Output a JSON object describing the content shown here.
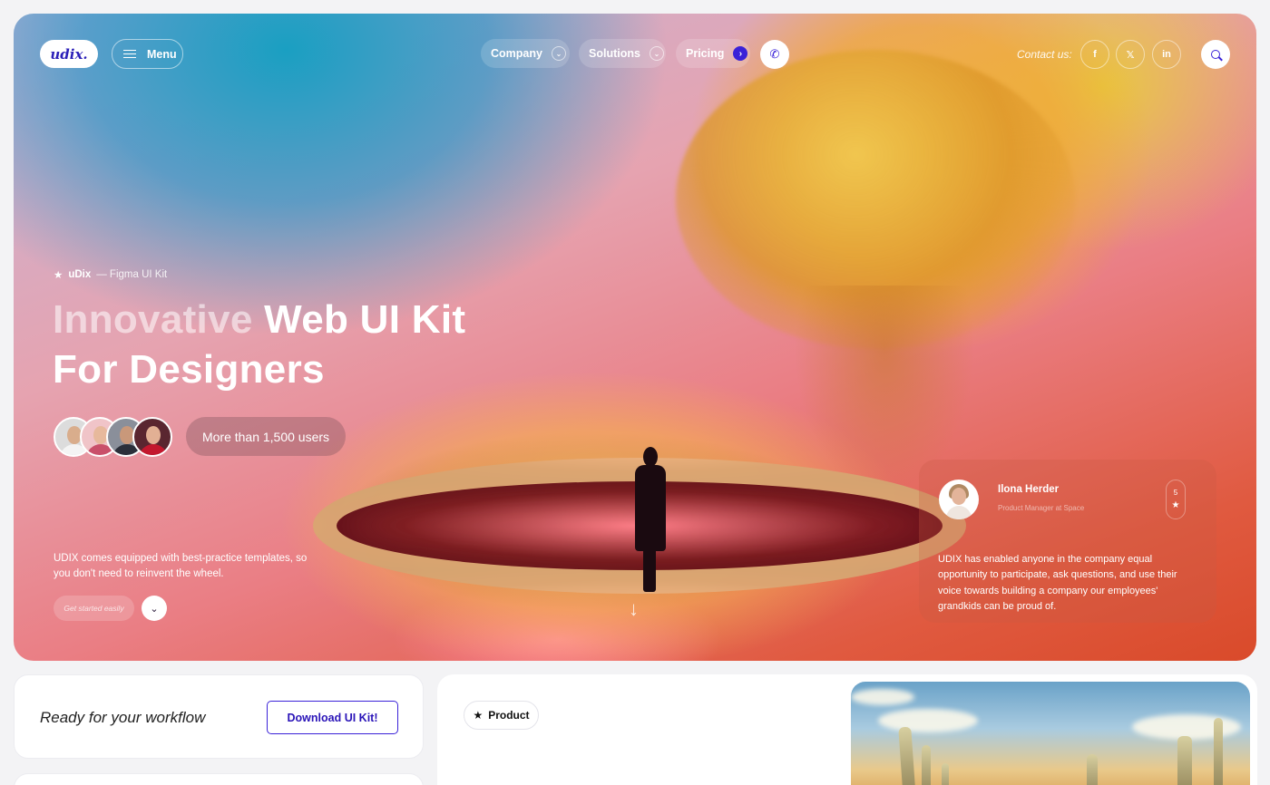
{
  "nav": {
    "logo": "udix.",
    "menu_label": "Menu",
    "items": [
      {
        "label": "Company",
        "chevron": "⌄"
      },
      {
        "label": "Solutions",
        "chevron": "⌄"
      },
      {
        "label": "Pricing",
        "chevron": "›"
      }
    ],
    "contact_label": "Contact us:",
    "socials": [
      {
        "icon": "facebook-icon",
        "glyph": "f"
      },
      {
        "icon": "x-icon",
        "glyph": "𝕏"
      },
      {
        "icon": "linkedin-icon",
        "glyph": "in"
      }
    ]
  },
  "hero": {
    "eyebrow_brand": "uDix",
    "eyebrow_rest": "— Figma UI Kit",
    "headline_faded": "Innovative",
    "headline_main": "Web UI Kit",
    "headline_line2": "For Designers",
    "users_label": "More than 1,500 users",
    "description": "UDIX comes equipped with best-practice templates, so you don't need to reinvent the wheel.",
    "get_started": "Get started easily"
  },
  "review": {
    "name": "Ilona Herder",
    "role": "Product Manager at Space",
    "rating": "5",
    "text": "UDIX has enabled anyone in the company equal opportunity to participate, ask questions, and use their voice towards building a company our employees' grandkids can be proud of."
  },
  "cta": {
    "text": "Ready for your workflow",
    "button": "Download UI Kit!"
  },
  "product": {
    "tag": "Product"
  },
  "colors": {
    "accent": "#3a22d8",
    "hero_teal": "#1a9fc2",
    "hero_orange": "#e05a40"
  }
}
